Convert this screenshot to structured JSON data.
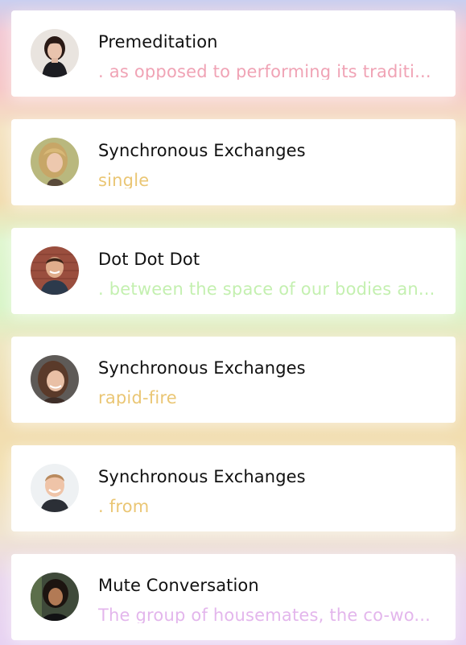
{
  "conversations": [
    {
      "title": "Premeditation",
      "snippet": ". as opposed to performing its traditi...",
      "color": "#f0a3b5",
      "avatar_icon": "avatar-woman-dark-hair"
    },
    {
      "title": "Synchronous Exchanges",
      "snippet": "single",
      "color": "#eac674",
      "avatar_icon": "avatar-woman-blonde"
    },
    {
      "title": "Dot Dot Dot",
      "snippet": ". between the space of our bodies an...",
      "color": "#c4f0b0",
      "avatar_icon": "avatar-man-brick-wall"
    },
    {
      "title": "Synchronous Exchanges",
      "snippet": "rapid-fire",
      "color": "#eac674",
      "avatar_icon": "avatar-woman-brunette"
    },
    {
      "title": "Synchronous Exchanges",
      "snippet": ". from",
      "color": "#eac674",
      "avatar_icon": "avatar-man-smiling"
    },
    {
      "title": "Mute Conversation",
      "snippet": "The group of housemates, the co-wo...",
      "color": "#e3b6ec",
      "avatar_icon": "avatar-person-curly-hair"
    }
  ]
}
